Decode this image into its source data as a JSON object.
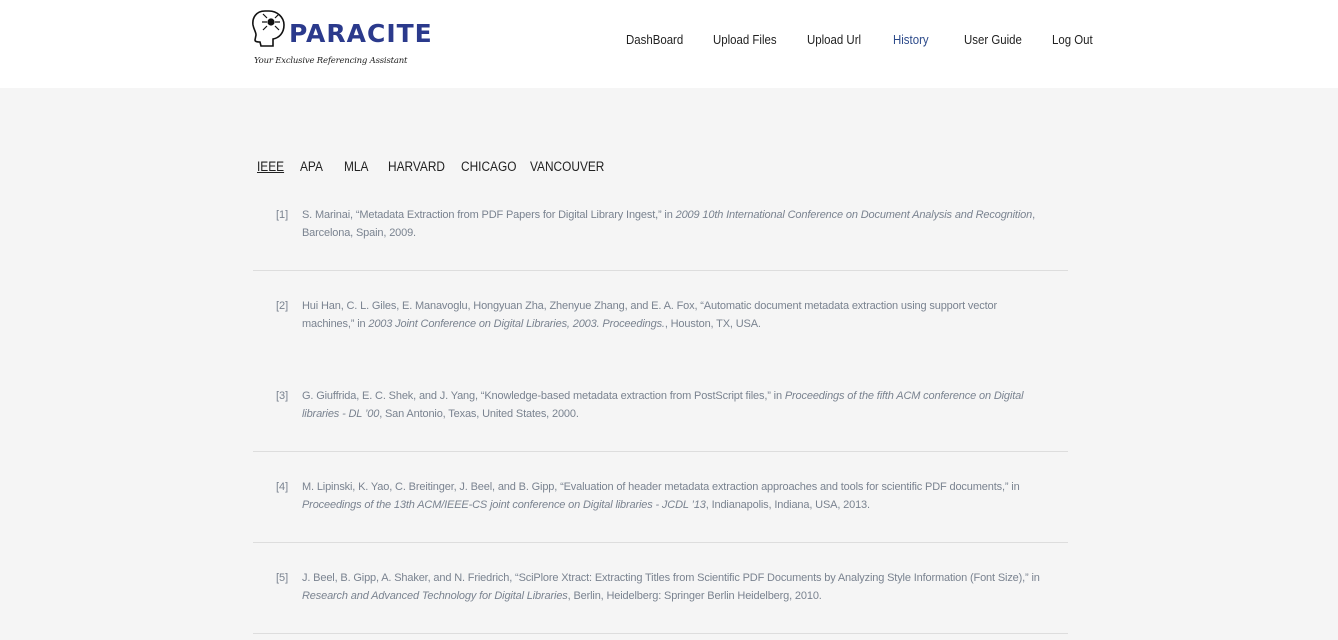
{
  "brand": {
    "name": "PARACITE",
    "tagline": "Your Exclusive Referencing Assistant"
  },
  "nav": {
    "items": [
      {
        "label": "DashBoard",
        "active": false
      },
      {
        "label": "Upload Files",
        "active": false
      },
      {
        "label": "Upload Url",
        "active": false
      },
      {
        "label": "History",
        "active": true
      },
      {
        "label": "User Guide",
        "active": false
      },
      {
        "label": "Log Out",
        "active": false
      }
    ]
  },
  "citation_tabs": {
    "items": [
      {
        "label": "IEEE",
        "active": true
      },
      {
        "label": "APA",
        "active": false
      },
      {
        "label": "MLA",
        "active": false
      },
      {
        "label": "HARVARD",
        "active": false
      },
      {
        "label": "CHICAGO",
        "active": false
      },
      {
        "label": "VANCOUVER",
        "active": false
      }
    ]
  },
  "references": [
    {
      "num": "[1]",
      "pre": "S. Marinai, “Metadata Extraction from PDF Papers for Digital Library Ingest,” in ",
      "venue": "2009 10th International Conference on Document Analysis and Recognition",
      "post": ", Barcelona, Spain, 2009."
    },
    {
      "num": "[2]",
      "pre": "Hui Han, C. L. Giles, E. Manavoglu, Hongyuan Zha, Zhenyue Zhang, and E. A. Fox, “Automatic document metadata extraction using support vector machines,” in ",
      "venue": "2003 Joint Conference on Digital Libraries, 2003. Proceedings.",
      "post": ", Houston, TX, USA."
    },
    {
      "num": "[3]",
      "pre": "G. Giuffrida, E. C. Shek, and J. Yang, “Knowledge-based metadata extraction from PostScript files,” in ",
      "venue": "Proceedings of the fifth ACM conference on Digital libraries  - DL ’00",
      "post": ", San Antonio, Texas, United States, 2000."
    },
    {
      "num": "[4]",
      "pre": "M. Lipinski, K. Yao, C. Breitinger, J. Beel, and B. Gipp, “Evaluation of header metadata extraction approaches and tools for scientific PDF documents,” in ",
      "venue": "Proceedings of the 13th ACM/IEEE-CS joint conference on Digital libraries - JCDL ’13",
      "post": ", Indianapolis, Indiana, USA, 2013."
    },
    {
      "num": "[5]",
      "pre": "J. Beel, B. Gipp, A. Shaker, and N. Friedrich, “SciPlore Xtract: Extracting Titles from Scientific PDF Documents by Analyzing Style Information (Font Size),” in ",
      "venue": "Research and Advanced Technology for Digital Libraries",
      "post": ", Berlin, Heidelberg: Springer Berlin Heidelberg, 2010."
    }
  ]
}
